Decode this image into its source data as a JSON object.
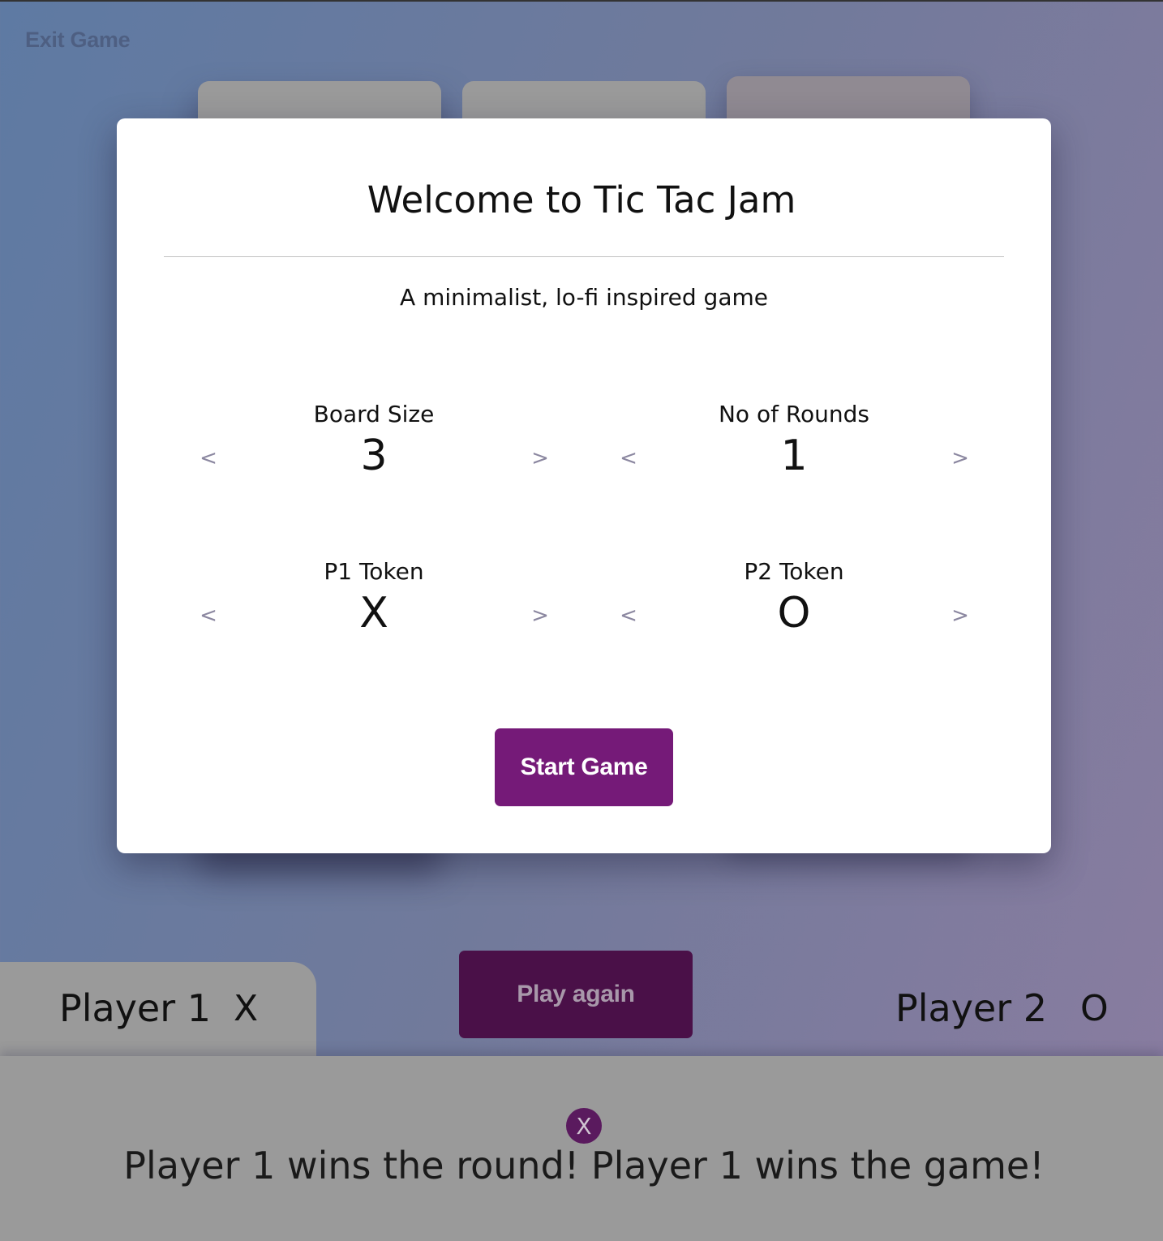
{
  "nav": {
    "exit_label": "Exit Game"
  },
  "modal": {
    "title": "Welcome to Tic Tac Jam",
    "subtitle": "A minimalist, lo-fi inspired game",
    "settings": {
      "board_size": {
        "label": "Board Size",
        "value": "3"
      },
      "rounds": {
        "label": "No of Rounds",
        "value": "1"
      },
      "p1_token": {
        "label": "P1 Token",
        "value": "X"
      },
      "p2_token": {
        "label": "P2 Token",
        "value": "O"
      }
    },
    "prev_arrow": "<",
    "next_arrow": ">",
    "start_label": "Start Game"
  },
  "players": {
    "p1": {
      "name": "Player 1",
      "token": "X"
    },
    "p2": {
      "name": "Player 2",
      "token": "O"
    }
  },
  "play_again_label": "Play again",
  "result": {
    "badge": "X",
    "message": "Player 1 wins the round! Player 1 wins the game!"
  },
  "colors": {
    "accent": "#751a78",
    "accent_dark": "#4a1048",
    "panel_gray": "#9a9a9a"
  }
}
